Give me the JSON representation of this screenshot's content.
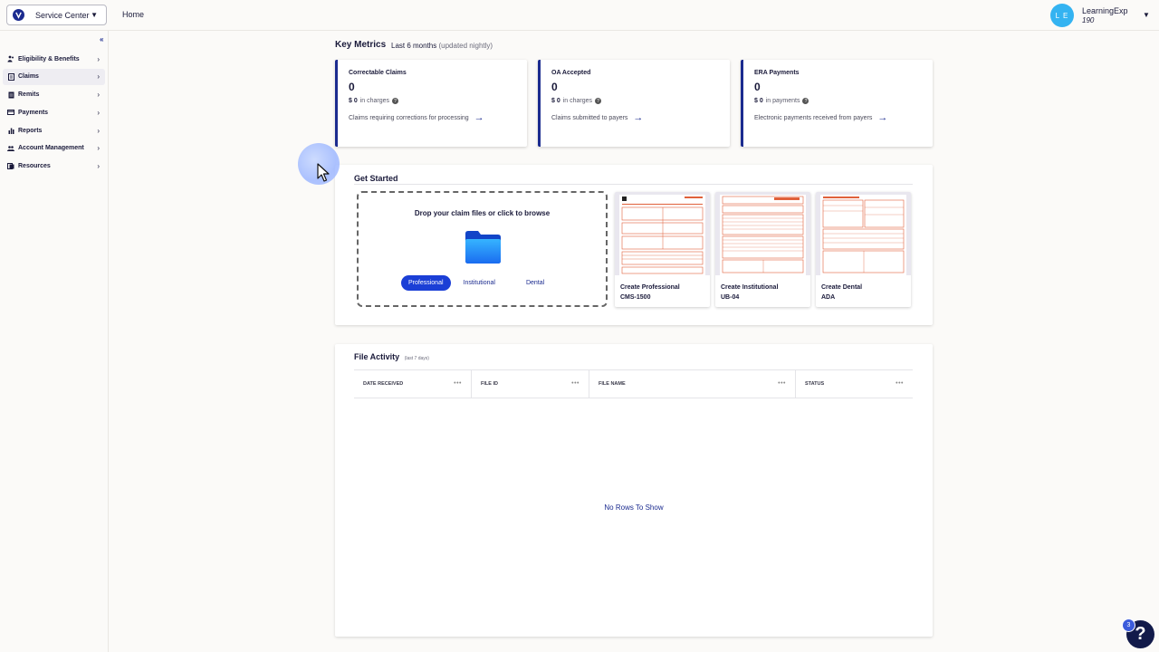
{
  "topbar": {
    "service_select": "Service Center",
    "home": "Home",
    "user": {
      "initials": "L E",
      "name": "LearningExp",
      "id": "190"
    }
  },
  "sidebar": {
    "collapse_icon": "double-chevron-left-icon",
    "items": [
      {
        "label": "Eligibility & Benefits",
        "icon": "people-icon",
        "active": false
      },
      {
        "label": "Claims",
        "icon": "document-icon",
        "active": true
      },
      {
        "label": "Remits",
        "icon": "receipt-icon",
        "active": false
      },
      {
        "label": "Payments",
        "icon": "credit-card-icon",
        "active": false
      },
      {
        "label": "Reports",
        "icon": "bar-chart-icon",
        "active": false
      },
      {
        "label": "Account Management",
        "icon": "users-icon",
        "active": false
      },
      {
        "label": "Resources",
        "icon": "book-icon",
        "active": false
      }
    ]
  },
  "key_metrics": {
    "title": "Key Metrics",
    "period": "Last 6 months",
    "note": "(updated nightly)",
    "cards": [
      {
        "title": "Correctable Claims",
        "value": "0",
        "amount": "$ 0",
        "amount_label": "in charges",
        "description": "Claims requiring corrections for processing"
      },
      {
        "title": "OA Accepted",
        "value": "0",
        "amount": "$ 0",
        "amount_label": "in charges",
        "description": "Claims submitted to payers"
      },
      {
        "title": "ERA Payments",
        "value": "0",
        "amount": "$ 0",
        "amount_label": "in payments",
        "description": "Electronic payments received from payers"
      }
    ]
  },
  "get_started": {
    "title": "Get Started",
    "dropzone_text": "Drop your claim files or click to browse",
    "claim_types": [
      "Professional",
      "Institutional",
      "Dental"
    ],
    "selected_type": "Professional",
    "forms": [
      {
        "line1": "Create Professional",
        "line2": "CMS-1500"
      },
      {
        "line1": "Create Institutional",
        "line2": "UB-04"
      },
      {
        "line1": "Create Dental",
        "line2": "ADA"
      }
    ]
  },
  "file_activity": {
    "title": "File Activity",
    "subtitle": "(last 7 days)",
    "columns": [
      "DATE RECEIVED",
      "FILE ID",
      "FILE NAME",
      "STATUS"
    ],
    "empty_text": "No Rows To Show"
  },
  "help": {
    "badge": "3",
    "label": "?"
  },
  "colors": {
    "brand": "#1b2b8f",
    "accent": "#1b3fd6",
    "avatar": "#34b3f1",
    "form_ink": "#e0603a"
  }
}
